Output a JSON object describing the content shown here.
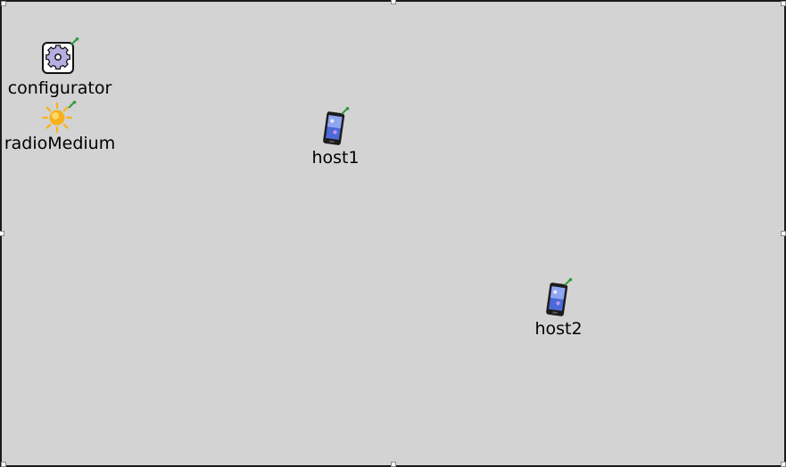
{
  "network": {
    "nodes": [
      {
        "id": "configurator",
        "label": "configurator",
        "icon": "gear-icon"
      },
      {
        "id": "radioMedium",
        "label": "radioMedium",
        "icon": "sun-icon"
      },
      {
        "id": "host1",
        "label": "host1",
        "icon": "mobile-phone-icon"
      },
      {
        "id": "host2",
        "label": "host2",
        "icon": "mobile-phone-icon"
      }
    ]
  },
  "colors": {
    "background": "#d3d3d3",
    "border": "#1a1a1a",
    "gear_fill": "#b6aee0",
    "sun_fill": "#f7b21a",
    "antenna": "#2f9a3a"
  }
}
